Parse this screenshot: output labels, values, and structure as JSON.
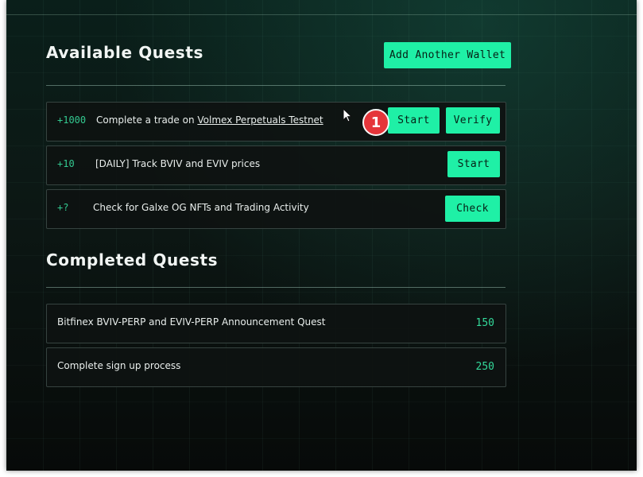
{
  "available": {
    "title": "Available Quests",
    "add_wallet_label": "Add Another Wallet",
    "quests": [
      {
        "points": "+1000",
        "text_prefix": "Complete a trade on ",
        "link": "Volmex Perpetuals Testnet",
        "start_label": "Start",
        "verify_label": "Verify"
      },
      {
        "points": "+10",
        "text": "[DAILY] Track BVIV and EVIV prices",
        "start_label": "Start"
      },
      {
        "points": "+?",
        "text": "Check for Galxe OG NFTs and Trading Activity",
        "check_label": "Check"
      }
    ]
  },
  "completed": {
    "title": "Completed Quests",
    "quests": [
      {
        "text": "Bitfinex BVIV-PERP and EVIV-PERP Announcement Quest",
        "points": "150"
      },
      {
        "text": "Complete sign up process",
        "points": "250"
      }
    ]
  },
  "annotation": {
    "step": "1"
  },
  "colors": {
    "accent": "#1ff0a6",
    "points": "#33c990",
    "badge": "#e5353a"
  }
}
